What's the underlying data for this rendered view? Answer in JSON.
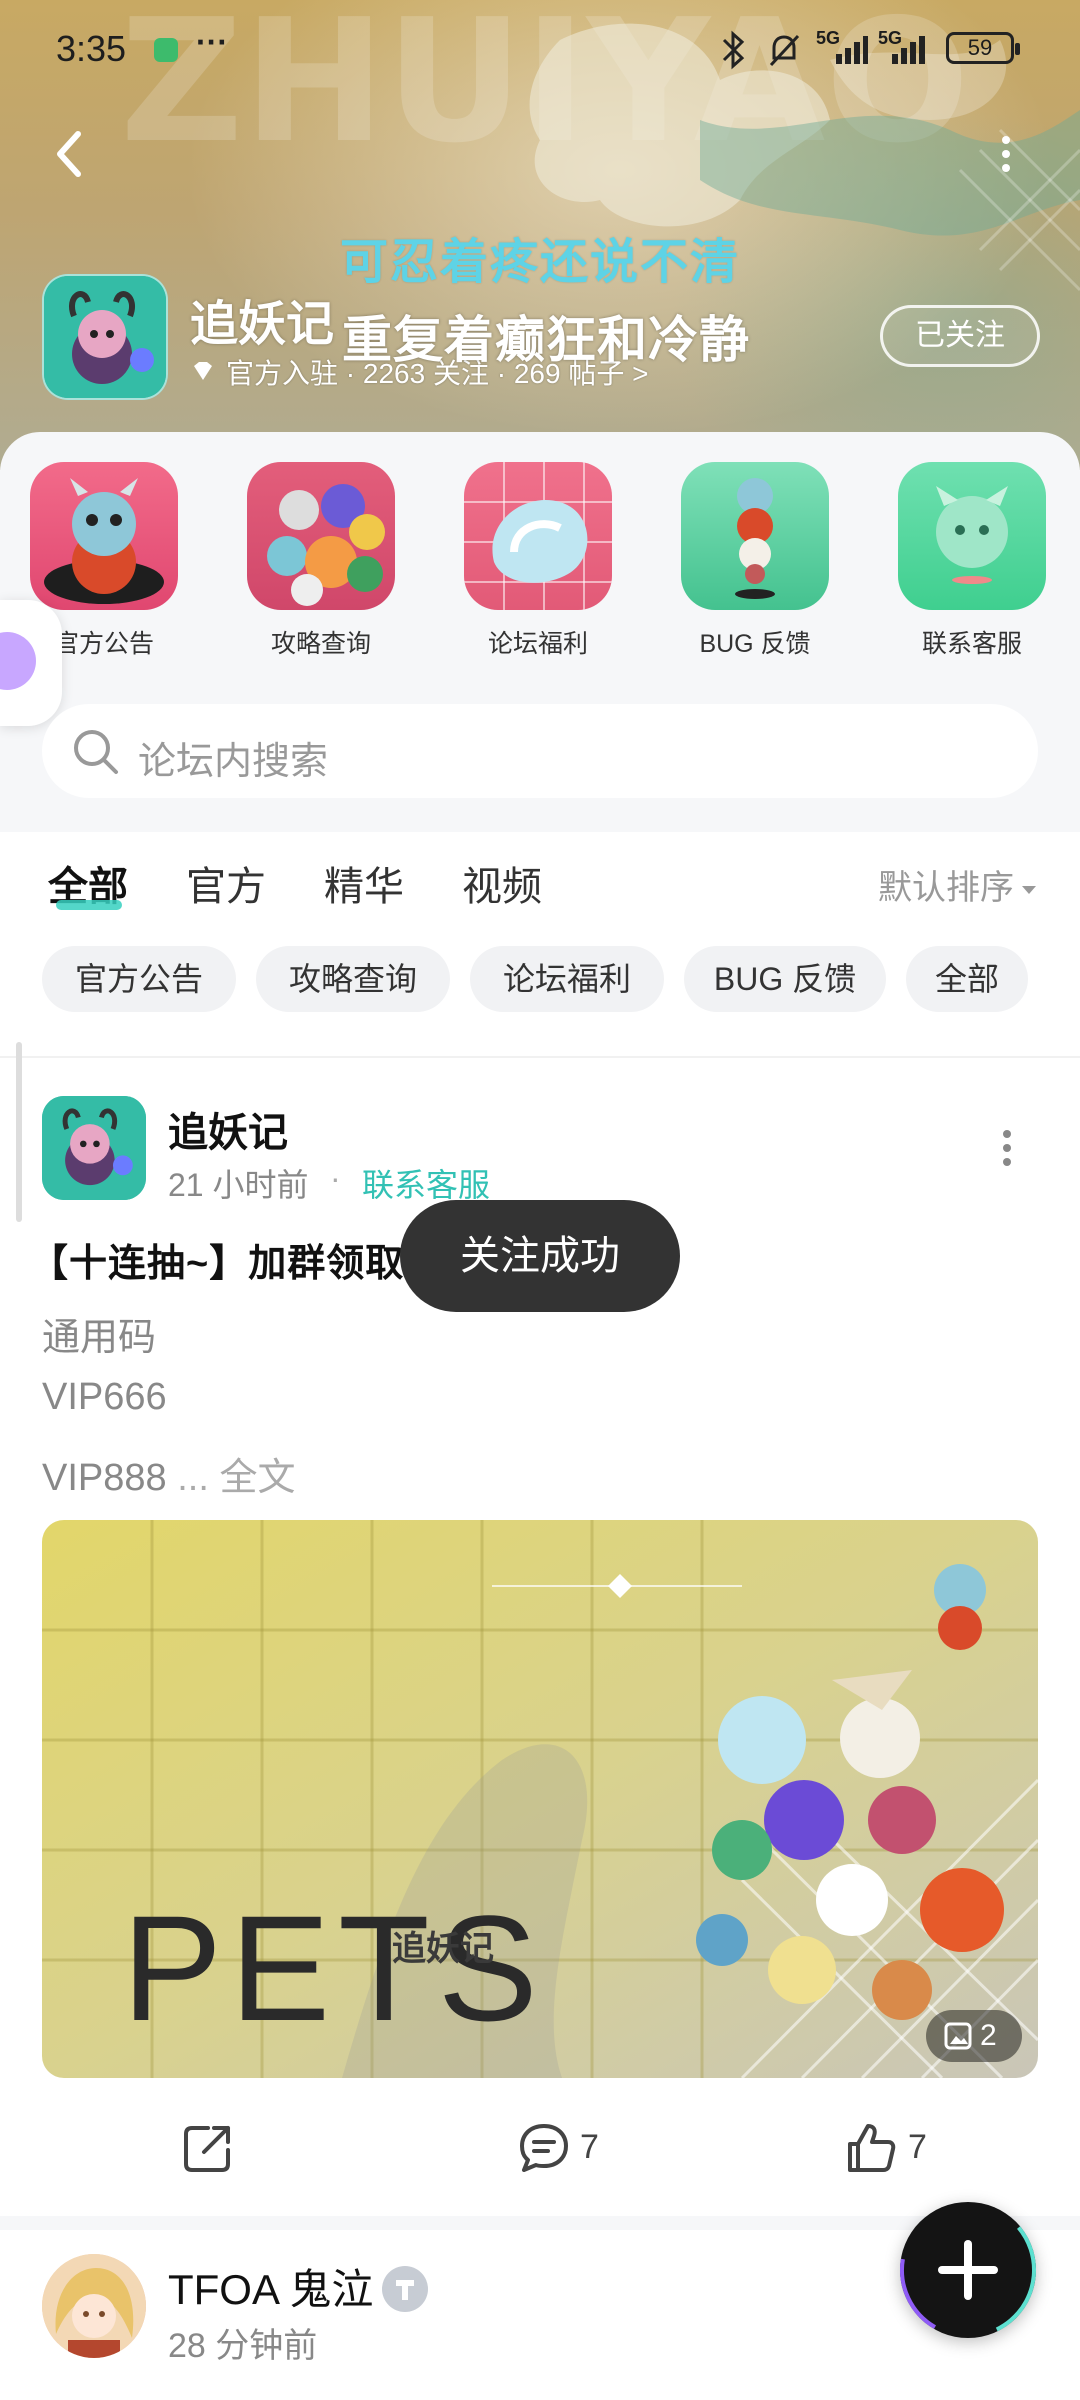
{
  "status_bar": {
    "time": "3:35",
    "more": "···",
    "network1": "5G",
    "network2": "5G",
    "battery": "59"
  },
  "header": {
    "lyric_line1": "可忍着疼还说不清",
    "lyric_line2": "重复着癫狂和冷静",
    "game_title": "追妖记",
    "stats": "官方入驻 · 2263 关注 · 269 帖子 >",
    "follow_button": "已关注"
  },
  "shortcuts": [
    {
      "label": "官方公告"
    },
    {
      "label": "攻略查询"
    },
    {
      "label": "论坛福利"
    },
    {
      "label": "BUG 反馈"
    },
    {
      "label": "联系客服"
    }
  ],
  "search": {
    "placeholder": "论坛内搜索"
  },
  "tabs": [
    {
      "label": "全部"
    },
    {
      "label": "官方"
    },
    {
      "label": "精华"
    },
    {
      "label": "视频"
    }
  ],
  "sort_label": "默认排序",
  "chips": [
    {
      "label": "官方公告"
    },
    {
      "label": "攻略查询"
    },
    {
      "label": "论坛福利"
    },
    {
      "label": "BUG 反馈"
    },
    {
      "label": "全部"
    }
  ],
  "post": {
    "author": "追妖记",
    "time": "21 小时前",
    "separator": "·",
    "tag": "联系客服",
    "title": "【十连抽~】加群领取",
    "lines": [
      "通用码",
      "VIP666"
    ],
    "last_line": "VIP888",
    "ellipsis": " ... ",
    "full_text_link": "全文",
    "image_text": "PETS",
    "image_text_cn": "追妖记",
    "image_count": "2",
    "comments": "7",
    "likes": "7"
  },
  "toast": "关注成功",
  "next_post": {
    "author": "TFOA 鬼泣",
    "time": "28 分钟前"
  },
  "colors": {
    "accent": "#32c1b4",
    "toast_bg": "#333333",
    "fab_bg": "#141414"
  }
}
